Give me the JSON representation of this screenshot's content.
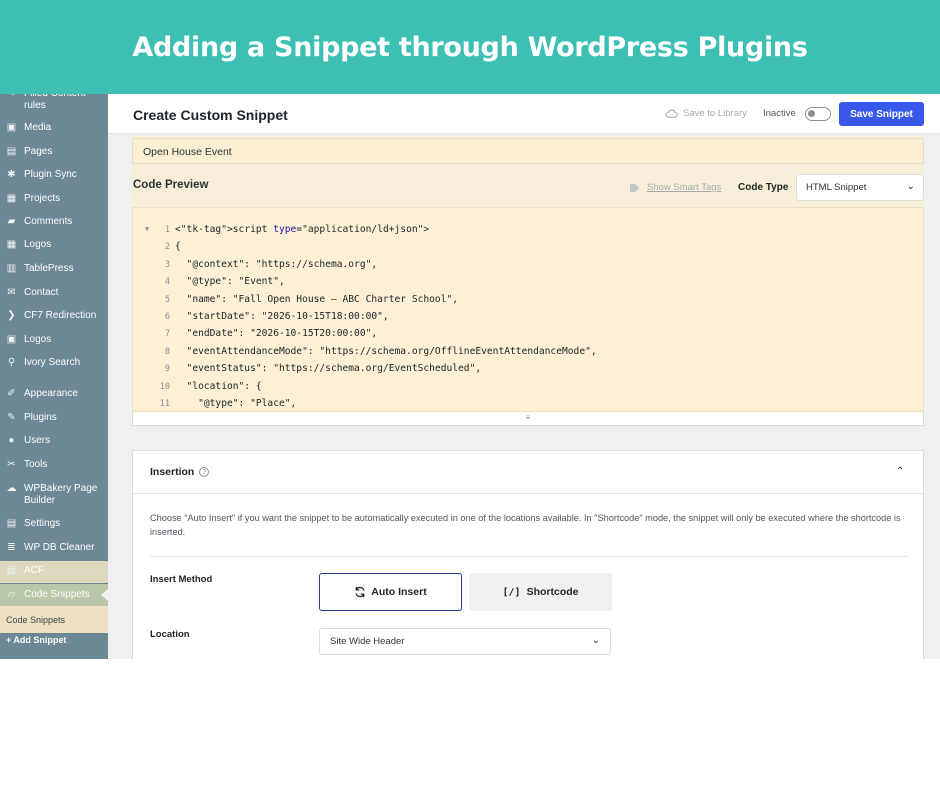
{
  "banner": {
    "title": "Adding a Snippet through WordPress Plugins"
  },
  "sidebar": {
    "items": [
      {
        "label": "Filled Content rules",
        "icon": "pin-icon",
        "glyph": "✎"
      },
      {
        "label": "Media",
        "icon": "media-icon",
        "glyph": "▣"
      },
      {
        "label": "Pages",
        "icon": "pages-icon",
        "glyph": "▤"
      },
      {
        "label": "Plugin Sync",
        "icon": "gear-icon",
        "glyph": "✱"
      },
      {
        "label": "Projects",
        "icon": "grid-icon",
        "glyph": "▦"
      },
      {
        "label": "Comments",
        "icon": "comment-icon",
        "glyph": "▰"
      },
      {
        "label": "Logos",
        "icon": "grid-icon",
        "glyph": "▦"
      },
      {
        "label": "TablePress",
        "icon": "table-icon",
        "glyph": "▥"
      },
      {
        "label": "Contact",
        "icon": "mail-icon",
        "glyph": "✉"
      },
      {
        "label": "CF7 Redirection",
        "icon": "redirect-icon",
        "glyph": "❯"
      },
      {
        "label": "Logos",
        "icon": "image-icon",
        "glyph": "▣"
      },
      {
        "label": "Ivory Search",
        "icon": "search-icon",
        "glyph": "⚲"
      },
      {
        "label": "Appearance",
        "icon": "brush-icon",
        "glyph": "✐"
      },
      {
        "label": "Plugins",
        "icon": "plug-icon",
        "glyph": "✎"
      },
      {
        "label": "Users",
        "icon": "user-icon",
        "glyph": "●"
      },
      {
        "label": "Tools",
        "icon": "wrench-icon",
        "glyph": "✂"
      },
      {
        "label": "WPBakery Page Builder",
        "icon": "cloud-icon",
        "glyph": "☁"
      },
      {
        "label": "Settings",
        "icon": "settings-icon",
        "glyph": "▤"
      },
      {
        "label": "WP DB Cleaner",
        "icon": "database-icon",
        "glyph": "≣"
      },
      {
        "label": "ACF",
        "icon": "acf-icon",
        "glyph": "▤"
      },
      {
        "label": "Code Snippets",
        "icon": "code-icon",
        "glyph": "▱"
      }
    ],
    "sub": {
      "current": "Code Snippets",
      "add": "+ Add Snippet"
    }
  },
  "header": {
    "title": "Create Custom Snippet",
    "save_library": "Save to Library",
    "status": "Inactive",
    "save_button": "Save Snippet"
  },
  "snippet": {
    "title": "Open House Event"
  },
  "code_preview": {
    "label": "Code Preview",
    "smart_tags": "Show Smart Tags",
    "code_type_label": "Code Type",
    "code_type_value": "HTML Snippet",
    "line_numbers": [
      "1",
      "2",
      "3",
      "4",
      "5",
      "6",
      "7",
      "8",
      "9",
      "10",
      "11"
    ],
    "lines": [
      "<script type=\"application/ld+json\">",
      "{",
      "  \"@context\": \"https://schema.org\",",
      "  \"@type\": \"Event\",",
      "  \"name\": \"Fall Open House – ABC Charter School\",",
      "  \"startDate\": \"2026-10-15T18:00:00\",",
      "  \"endDate\": \"2026-10-15T20:00:00\",",
      "  \"eventAttendanceMode\": \"https://schema.org/OfflineEventAttendanceMode\",",
      "  \"eventStatus\": \"https://schema.org/EventScheduled\",",
      "  \"location\": {",
      "    \"@type\": \"Place\","
    ]
  },
  "insertion": {
    "title": "Insertion",
    "description": "Choose \"Auto Insert\" if you want the snippet to be automatically executed in one of the locations available. In \"Shortcode\" mode, the snippet will only be executed where the shortcode is inserted.",
    "insert_method_label": "Insert Method",
    "auto_insert": "Auto Insert",
    "shortcode": "Shortcode",
    "location_label": "Location",
    "location_value": "Site Wide Header"
  }
}
